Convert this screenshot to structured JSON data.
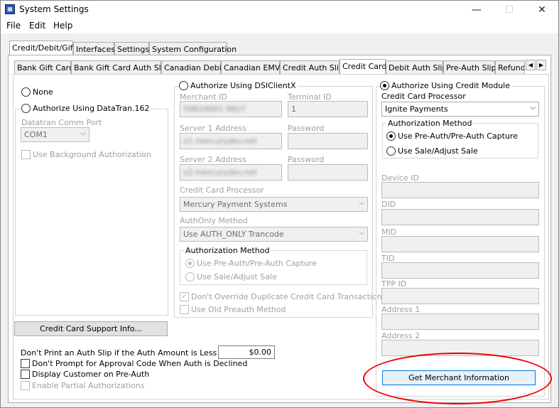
{
  "window": {
    "title": "System Settings"
  },
  "menu": [
    "File",
    "Edit",
    "Help"
  ],
  "top_tabs": [
    "Credit/Debit/Gift",
    "Interfaces",
    "Settings",
    "System Configuration"
  ],
  "sub_tabs": [
    "Bank Gift Card",
    "Bank Gift Card Auth Slip",
    "Canadian Debit",
    "Canadian EMV",
    "Credit Auth Slip",
    "Credit Card",
    "Debit Auth Slip",
    "Pre-Auth Slip",
    "Refund"
  ],
  "left": {
    "none_label": "None",
    "datatran_label": "Authorize Using DataTran.162",
    "comm_port_label": "Datatran Comm Port",
    "comm_port_value": "COM1",
    "background_auth_label": "Use Background Authorization",
    "support_button": "Credit Card Support Info...",
    "auth_amount_label": "Don't Print an Auth Slip if the Auth Amount is Less Than",
    "auth_amount_value": "$0.00",
    "no_prompt_label": "Don't Prompt for Approval Code When Auth is Declined",
    "display_customer_label": "Display Customer on Pre-Auth",
    "partial_auth_label": "Enable Partial Authorizations"
  },
  "dsi": {
    "radio_label": "Authorize Using DSIClientX",
    "merchant_id_label": "Merchant ID",
    "merchant_id_value": "59810001-9827",
    "terminal_id_label": "Terminal ID",
    "terminal_id_value": "1",
    "server1_label": "Server 1 Address",
    "server1_value": "x1.mercurydev.net",
    "password1_label": "Password",
    "server2_label": "Server 2 Address",
    "server2_value": "x2.mercurydev.net",
    "password2_label": "Password",
    "processor_label": "Credit Card Processor",
    "processor_value": "Mercury Payment Systems",
    "authonly_label": "AuthOnly Method",
    "authonly_value": "Use AUTH_ONLY Trancode",
    "auth_method_label": "Authorization Method",
    "preauth_label": "Use Pre-Auth/Pre-Auth Capture",
    "sale_label": "Use Sale/Adjust Sale",
    "no_override_label": "Don't Override Duplicate Credit Card Transactions",
    "old_preauth_label": "Use Old Preauth Method"
  },
  "module": {
    "radio_label": "Authorize Using Credit Module",
    "processor_label": "Credit Card Processor",
    "processor_value": "Ignite Payments",
    "auth_method_label": "Authorization Method",
    "preauth_label": "Use Pre-Auth/Pre-Auth Capture",
    "sale_label": "Use Sale/Adjust Sale",
    "device_id_label": "Device ID",
    "did_label": "DID",
    "mid_label": "MID",
    "tid_label": "TID",
    "tpp_id_label": "TPP ID",
    "address1_label": "Address 1",
    "address2_label": "Address 2",
    "merchant_button": "Get Merchant Information"
  },
  "colors": {
    "highlight": "#e00000",
    "button_focus": "#0078d7"
  }
}
